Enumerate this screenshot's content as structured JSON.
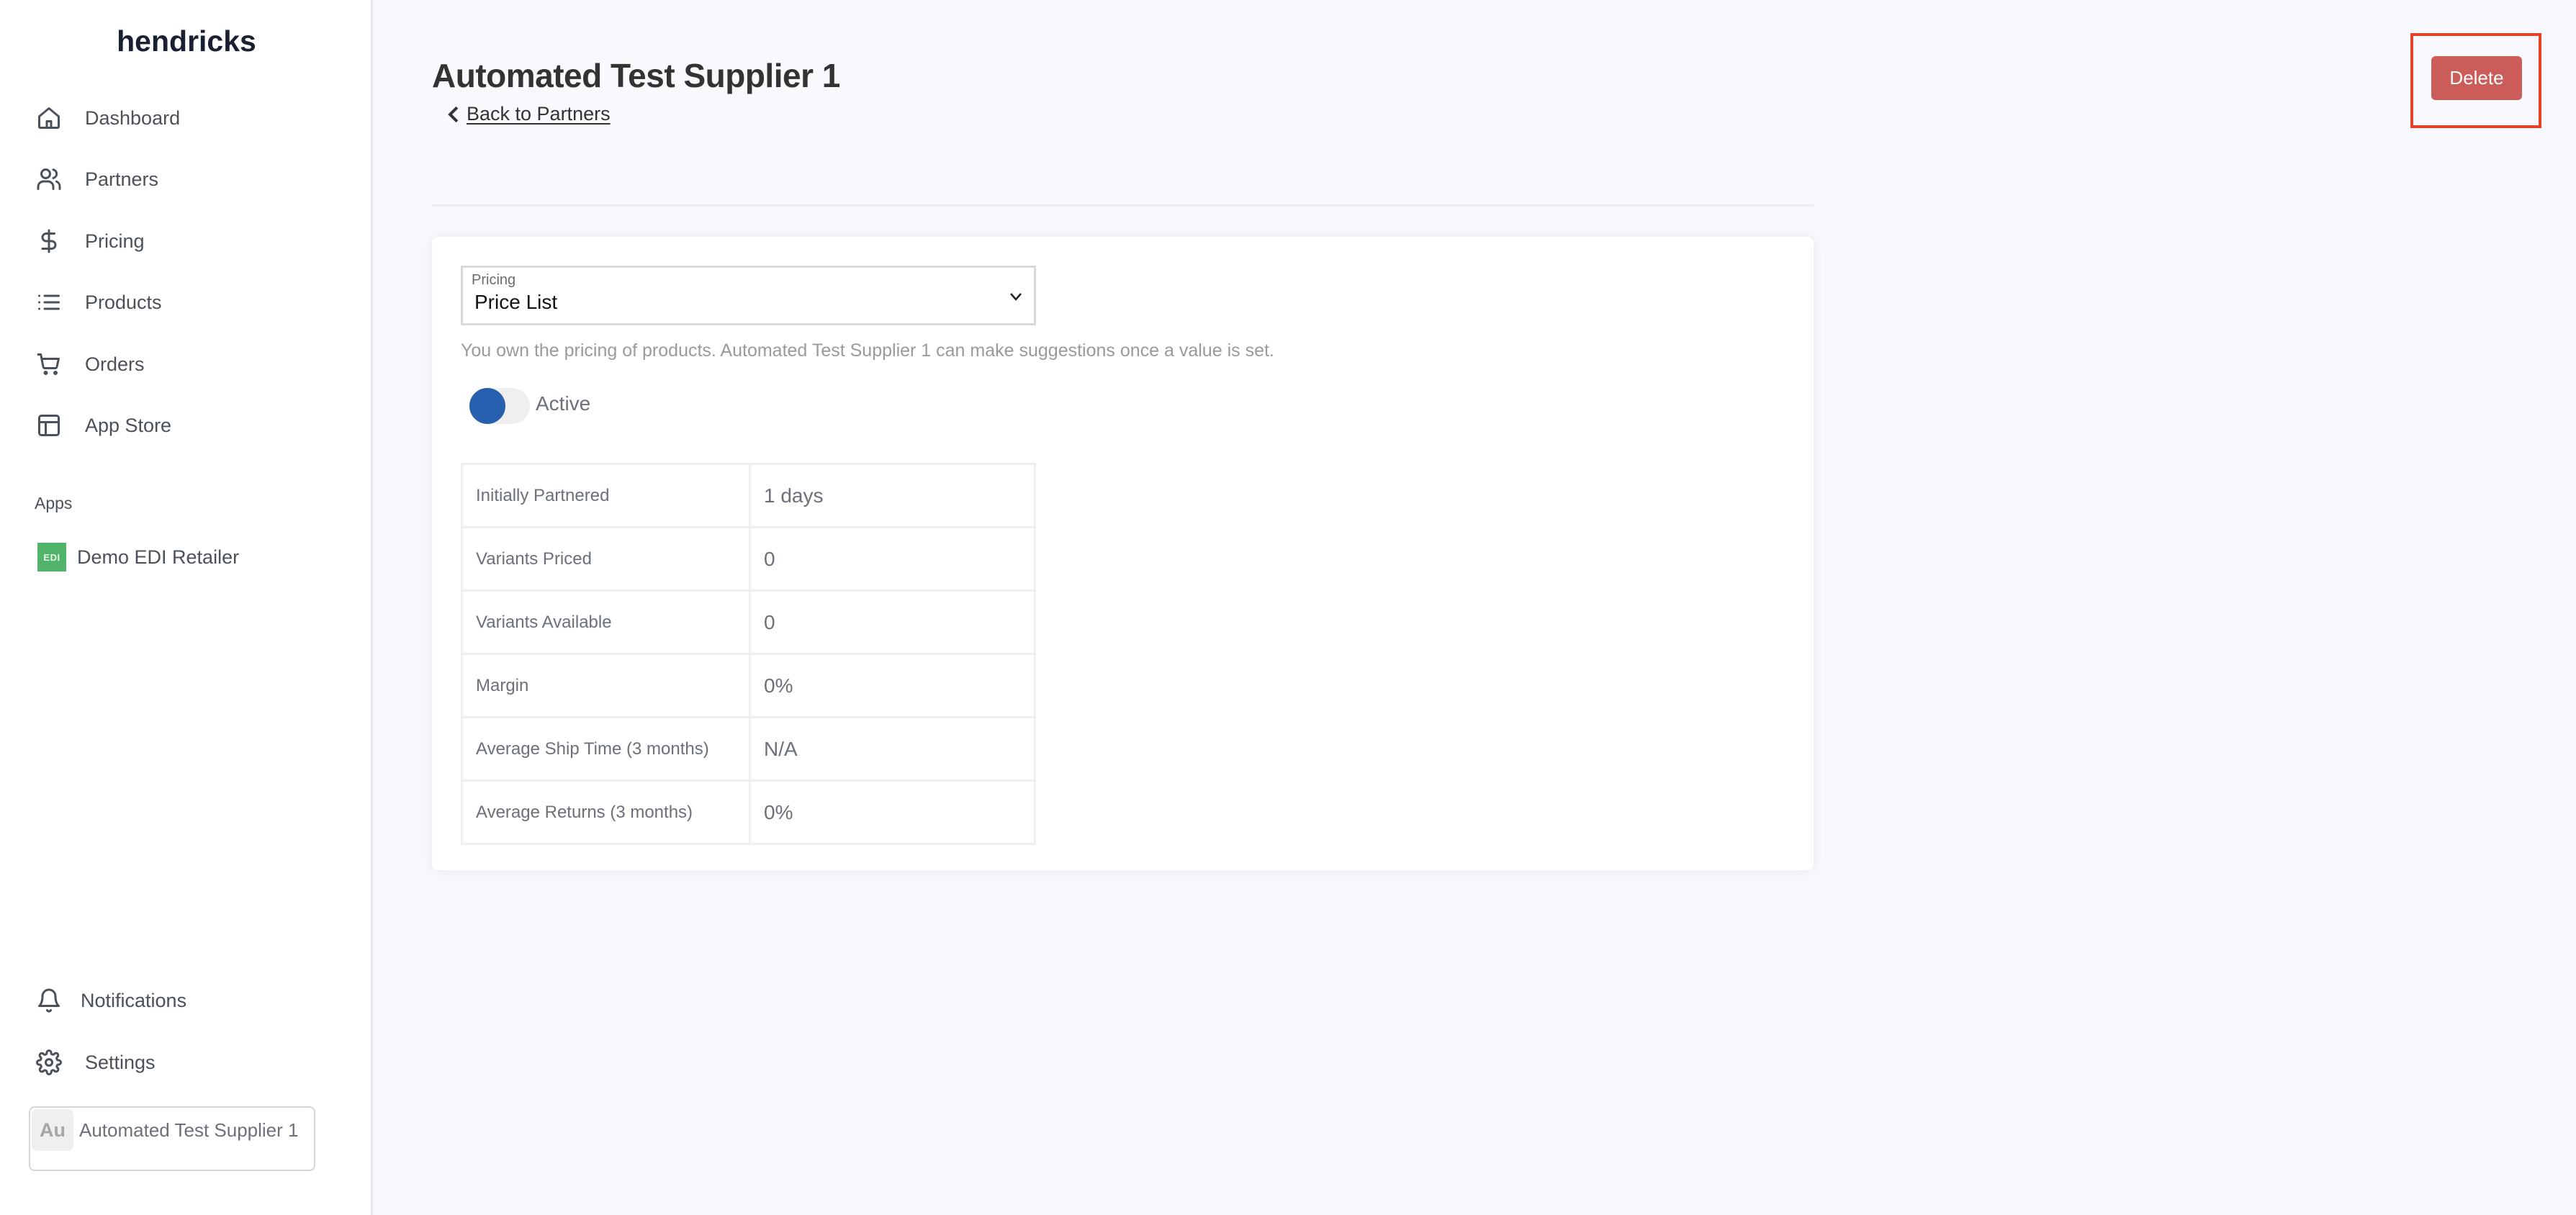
{
  "sidebar": {
    "logo": "hendricks",
    "nav": [
      {
        "label": "Dashboard",
        "icon": "home-icon"
      },
      {
        "label": "Partners",
        "icon": "users-icon"
      },
      {
        "label": "Pricing",
        "icon": "dollar-icon"
      },
      {
        "label": "Products",
        "icon": "list-icon"
      },
      {
        "label": "Orders",
        "icon": "cart-icon"
      },
      {
        "label": "App Store",
        "icon": "layout-icon"
      }
    ],
    "apps_heading": "Apps",
    "apps": [
      {
        "badge": "EDI",
        "label": "Demo EDI Retailer",
        "badge_color": "#52b46a"
      }
    ],
    "bottom": [
      {
        "label": "Notifications",
        "icon": "bell-icon"
      },
      {
        "label": "Settings",
        "icon": "gear-icon"
      }
    ],
    "account": {
      "initials": "Au",
      "name": "Automated Test Supplier 1"
    }
  },
  "header": {
    "title": "Automated Test Supplier 1",
    "back_label": "Back to Partners",
    "delete_label": "Delete",
    "delete_color": "#cb5c57",
    "highlight_color": "#e8412a"
  },
  "pricing": {
    "select_label": "Pricing",
    "select_value": "Price List",
    "help_text": "You own the pricing of products. Automated Test Supplier 1 can make suggestions once a value is set.",
    "toggle_label": "Active",
    "toggle_on": true,
    "toggle_color": "#2860b0"
  },
  "stats": [
    {
      "label": "Initially Partnered",
      "value": "1 days"
    },
    {
      "label": "Variants Priced",
      "value": "0"
    },
    {
      "label": "Variants Available",
      "value": "0"
    },
    {
      "label": "Margin",
      "value": "0%"
    },
    {
      "label": "Average Ship Time (3 months)",
      "value": "N/A"
    },
    {
      "label": "Average Returns (3 months)",
      "value": "0%"
    }
  ]
}
